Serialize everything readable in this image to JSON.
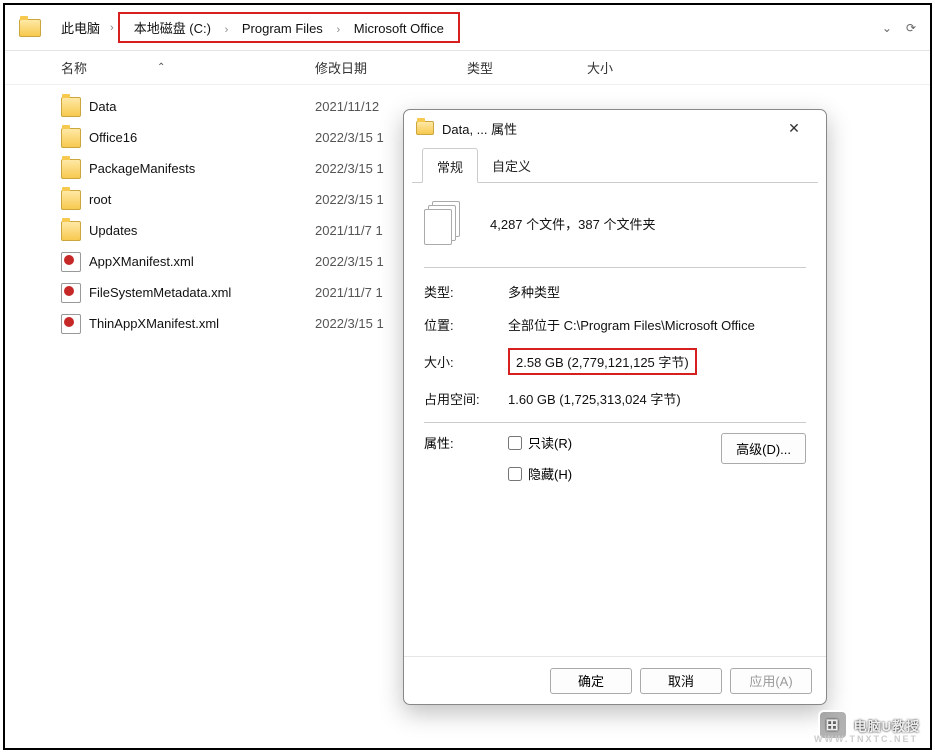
{
  "breadcrumb": {
    "root": "此电脑",
    "parts": [
      "本地磁盘 (C:)",
      "Program Files",
      "Microsoft Office"
    ]
  },
  "columns": {
    "name": "名称",
    "modified": "修改日期",
    "type": "类型",
    "size": "大小"
  },
  "files": [
    {
      "name": "Data",
      "date": "2021/11/12",
      "kind": "folder"
    },
    {
      "name": "Office16",
      "date": "2022/3/15 1",
      "kind": "folder"
    },
    {
      "name": "PackageManifests",
      "date": "2022/3/15 1",
      "kind": "folder"
    },
    {
      "name": "root",
      "date": "2022/3/15 1",
      "kind": "folder"
    },
    {
      "name": "Updates",
      "date": "2021/11/7 1",
      "kind": "folder"
    },
    {
      "name": "AppXManifest.xml",
      "date": "2022/3/15 1",
      "kind": "xml"
    },
    {
      "name": "FileSystemMetadata.xml",
      "date": "2021/11/7 1",
      "kind": "xml"
    },
    {
      "name": "ThinAppXManifest.xml",
      "date": "2022/3/15 1",
      "kind": "xml"
    }
  ],
  "dialog": {
    "title": "Data, ... 属性",
    "tabs": {
      "general": "常规",
      "custom": "自定义"
    },
    "summary": "4,287 个文件，387 个文件夹",
    "rows": {
      "type_label": "类型:",
      "type_value": "多种类型",
      "location_label": "位置:",
      "location_value": "全部位于 C:\\Program Files\\Microsoft Office",
      "size_label": "大小:",
      "size_value": "2.58 GB (2,779,121,125 字节)",
      "ondisk_label": "占用空间:",
      "ondisk_value": "1.60 GB (1,725,313,024 字节)"
    },
    "attrs": {
      "label": "属性:",
      "readonly": "只读(R)",
      "hidden": "隐藏(H)",
      "advanced": "高级(D)..."
    },
    "buttons": {
      "ok": "确定",
      "cancel": "取消",
      "apply": "应用(A)"
    }
  },
  "watermark": {
    "text": "电脑U教授",
    "sub": "WWW.TNXTC.NET",
    "logo": "⊞"
  }
}
